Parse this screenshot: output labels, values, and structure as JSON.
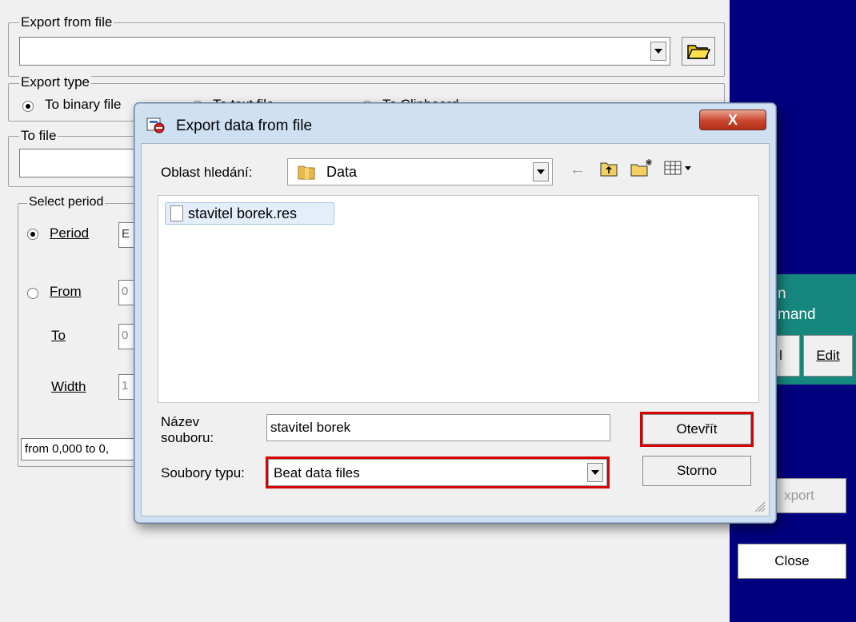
{
  "background": {
    "export_from_file_legend": "Export from file",
    "export_type_legend": "Export type",
    "radio_binary": "To binary file",
    "radio_text": "To text file",
    "radio_clipboard": "To Clipboard",
    "to_file_legend": "To file",
    "select_period_legend": "Select period",
    "period_label": "Period",
    "period_value": "E",
    "from_label": "From",
    "from_value": "0",
    "to_label": "To",
    "to_value": "0",
    "width_label": "Width",
    "width_value": "1",
    "range_text": "from 0,000 to 0,",
    "teal_line1": "n",
    "teal_line2": "mand",
    "edit_button": "Edit",
    "partial_button": "l",
    "export_button": "xport",
    "close_button": "Close"
  },
  "dialog": {
    "title": "Export data from file",
    "close_symbol": "X",
    "look_in_label": "Oblast hledání:",
    "look_in_value": "Data",
    "files": [
      "stavitel borek.res"
    ],
    "filename_label_line1": "Název",
    "filename_label_line2": "souboru:",
    "filename_value": "stavitel borek",
    "filetype_label": "Soubory typu:",
    "filetype_value": "Beat data files",
    "open_button": "Otevřít",
    "cancel_button": "Storno"
  },
  "icons": {
    "back": "back-arrow-icon",
    "up": "up-folder-icon",
    "new_folder": "new-folder-icon",
    "view": "view-menu-icon"
  },
  "colors": {
    "highlight": "#d60000",
    "right_panel": "#00007f",
    "teal_panel": "#16877e"
  }
}
